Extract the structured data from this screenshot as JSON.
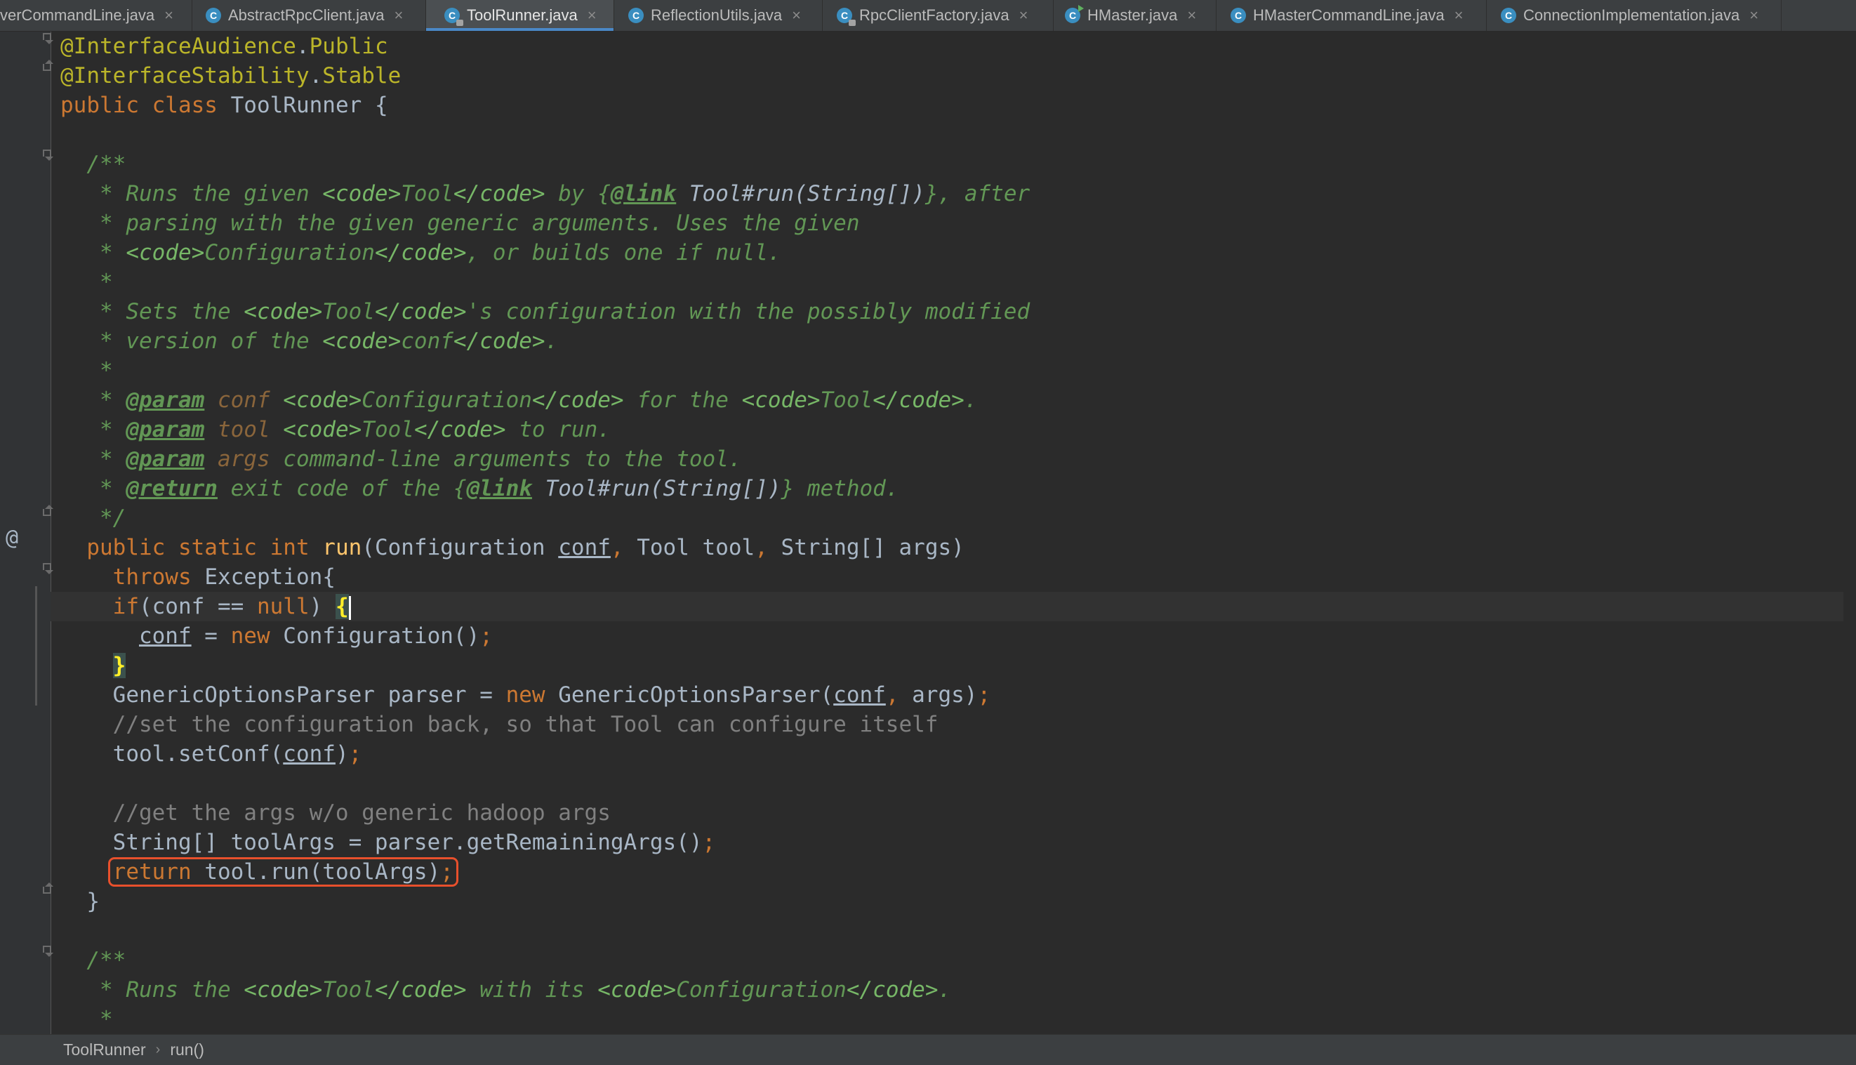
{
  "tabs": [
    {
      "label": "verCommandLine.java",
      "icon": "class-icon",
      "active": false
    },
    {
      "label": "AbstractRpcClient.java",
      "icon": "abstract-class-icon",
      "active": false
    },
    {
      "label": "ToolRunner.java",
      "icon": "locked-class-icon",
      "active": true
    },
    {
      "label": "ReflectionUtils.java",
      "icon": "class-icon",
      "active": false
    },
    {
      "label": "RpcClientFactory.java",
      "icon": "locked-class-icon",
      "active": false
    },
    {
      "label": "HMaster.java",
      "icon": "runnable-class-icon",
      "active": false
    },
    {
      "label": "HMasterCommandLine.java",
      "icon": "class-icon",
      "active": false
    },
    {
      "label": "ConnectionImplementation.java",
      "icon": "class-icon",
      "active": false
    }
  ],
  "editor": {
    "class_name": "ToolRunner",
    "gutter_override_icon": "@",
    "highlighted_statement": "return tool.run(toolArgs);"
  },
  "breadcrumb": [
    "ToolRunner",
    "run()"
  ],
  "colors": {
    "background": "#2b2b2b",
    "keyword": "#cc7832",
    "annotation": "#bbb529",
    "method": "#ffc66d",
    "javadoc": "#629755",
    "comment": "#808080",
    "highlight_box": "#e8502c"
  }
}
